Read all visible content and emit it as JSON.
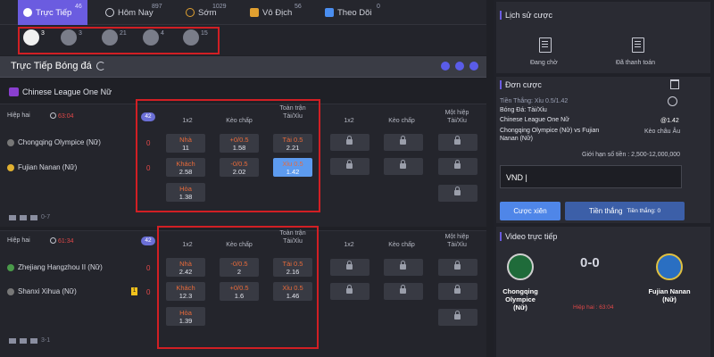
{
  "tabs": [
    {
      "label": "Trực Tiếp",
      "count": "46",
      "icon": "soccer-ball-icon"
    },
    {
      "label": "Hôm Nay",
      "count": "897",
      "icon": "calendar-icon"
    },
    {
      "label": "Sớm",
      "count": "1029",
      "icon": "alarm-clock-icon"
    },
    {
      "label": "Vô Địch",
      "count": "56",
      "icon": "trophy-icon"
    },
    {
      "label": "Theo Dõi",
      "count": "0",
      "icon": "star-icon"
    }
  ],
  "sports": [
    {
      "icon": "soccer-ball-icon",
      "count": "3"
    },
    {
      "icon": "basketball-icon",
      "count": "3"
    },
    {
      "icon": "tennis-ball-icon",
      "count": "21"
    },
    {
      "icon": "volleyball-icon",
      "count": "4"
    },
    {
      "icon": "table-tennis-icon",
      "count": "15"
    }
  ],
  "section_title": "Trực Tiếp Bóng đá",
  "league": "Chinese League One Nữ",
  "col_headers": {
    "h1x2": "1x2",
    "hcap": "Kèo chấp",
    "ou_line1": "Toàn trận",
    "ou_line2": "Tài/Xỉu",
    "half_line1": "Một hiệp",
    "half_line2": "Tài/Xỉu"
  },
  "matches": [
    {
      "period": "Hiệp hai",
      "time": "63:04",
      "markets": "42",
      "home": "Chongqing Olympice (Nữ)",
      "away": "Fujian Nanan (Nữ)",
      "home_score": "0",
      "away_score": "0",
      "footer": "0-7",
      "odds_1x2": [
        {
          "label": "Nhà",
          "value": "11"
        },
        {
          "label": "Khách",
          "value": "2.58"
        },
        {
          "label": "Hòa",
          "value": "1.38"
        }
      ],
      "odds_hcap": [
        {
          "label": "+0/0.5",
          "value": "1.58"
        },
        {
          "label": "-0/0.5",
          "value": "2.02"
        }
      ],
      "odds_ou": [
        {
          "label": "Tài 0.5",
          "value": "2.21"
        },
        {
          "label": "Xỉu 0.5",
          "value": "1.42"
        }
      ]
    },
    {
      "period": "Hiệp hai",
      "time": "61:34",
      "markets": "42",
      "home": "Zhejiang Hangzhou II (Nữ)",
      "away": "Shanxi Xihua (Nữ)",
      "home_score": "0",
      "away_score": "0",
      "yellow": "1",
      "footer": "3-1",
      "odds_1x2": [
        {
          "label": "Nhà",
          "value": "2.42"
        },
        {
          "label": "Khách",
          "value": "12.3"
        },
        {
          "label": "Hòa",
          "value": "1.39"
        }
      ],
      "odds_hcap": [
        {
          "label": "-0/0.5",
          "value": "2"
        },
        {
          "label": "+0/0.5",
          "value": "1.6"
        }
      ],
      "odds_ou": [
        {
          "label": "Tài 0.5",
          "value": "2.16"
        },
        {
          "label": "Xỉu 0.5",
          "value": "1.46"
        }
      ]
    }
  ],
  "right": {
    "history_title": "Lịch sử cược",
    "pending": "Đang chờ",
    "paid": "Đã thanh toán",
    "slip_title": "Đơn cược",
    "bet_market": "Tiền Thắng: Xỉu 0.5/1.42",
    "bet_type": "Bóng Đá: Tài/Xỉu",
    "bet_league": "Chinese League One Nữ",
    "bet_odds": "@1.42",
    "bet_match": "Chongqing Olympice (Nữ) vs Fujian Nanan (Nữ)",
    "bet_odds_type": "Kèo châu Âu",
    "limit": "Giới hạn số tiền : 2,500-12,000,000",
    "currency": "VND",
    "place_btn": "Cược xiên",
    "win_btn": "Tiền thắng",
    "win_amount": "Tiền thắng: 0",
    "video_title": "Video trực tiếp",
    "home": "Chongqing Olympice (Nữ)",
    "away": "Fujian Nanan (Nữ)",
    "score": "0-0",
    "status": "Hiệp hai : 63:04"
  }
}
